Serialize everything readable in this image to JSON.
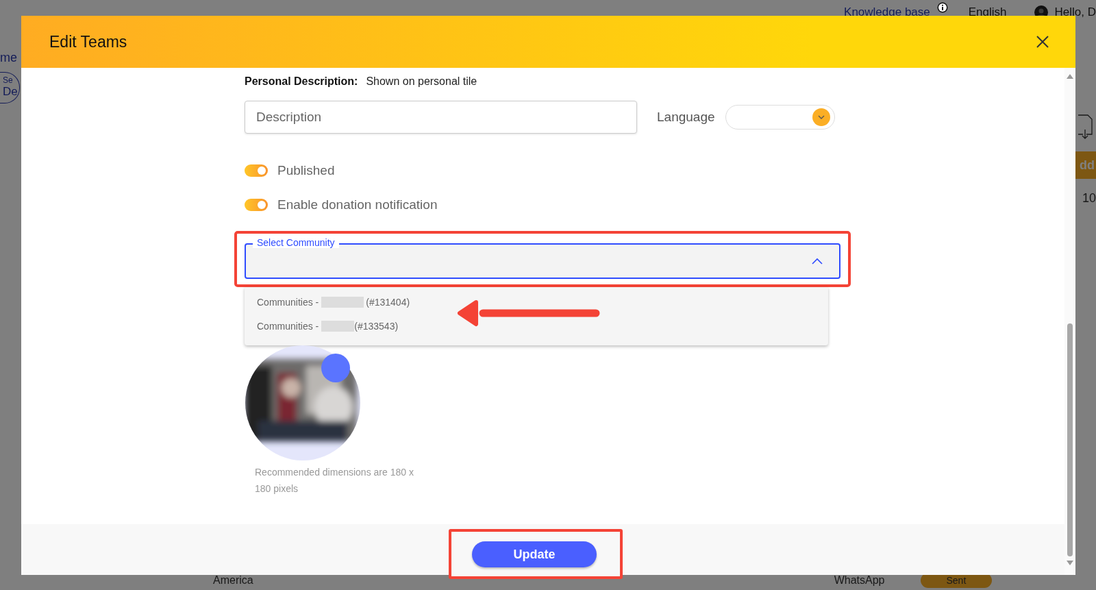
{
  "background_page": {
    "top_bar": {
      "knowledge_base_link": "Knowledge base",
      "language": "English",
      "greeting": "Hello, D"
    },
    "left_edge": {
      "nav_link": "me",
      "search_label": "Se",
      "search_value": "De"
    },
    "right_edge": {
      "add_button": "dd",
      "page_size": "10"
    },
    "bottom_row": {
      "country": "America",
      "channel": "WhatsApp",
      "status": "Sent"
    }
  },
  "dialog": {
    "title": "Edit Teams",
    "personal_description": {
      "label": "Personal Description:",
      "hint": "Shown on personal tile"
    },
    "description_field": {
      "placeholder": "Description"
    },
    "language": {
      "label": "Language"
    },
    "toggles": [
      {
        "label": "Published",
        "on": true
      },
      {
        "label": "Enable donation notification",
        "on": true
      }
    ],
    "community_select": {
      "label": "Select Community",
      "expanded": true,
      "options": [
        {
          "prefix": "Communities -",
          "code": "(#131404)"
        },
        {
          "prefix": "Communities -",
          "code": "(#133543)"
        }
      ]
    },
    "image_hint": "Recommended dimensions are 180 x 180 pixels",
    "update_button": "Update"
  }
}
